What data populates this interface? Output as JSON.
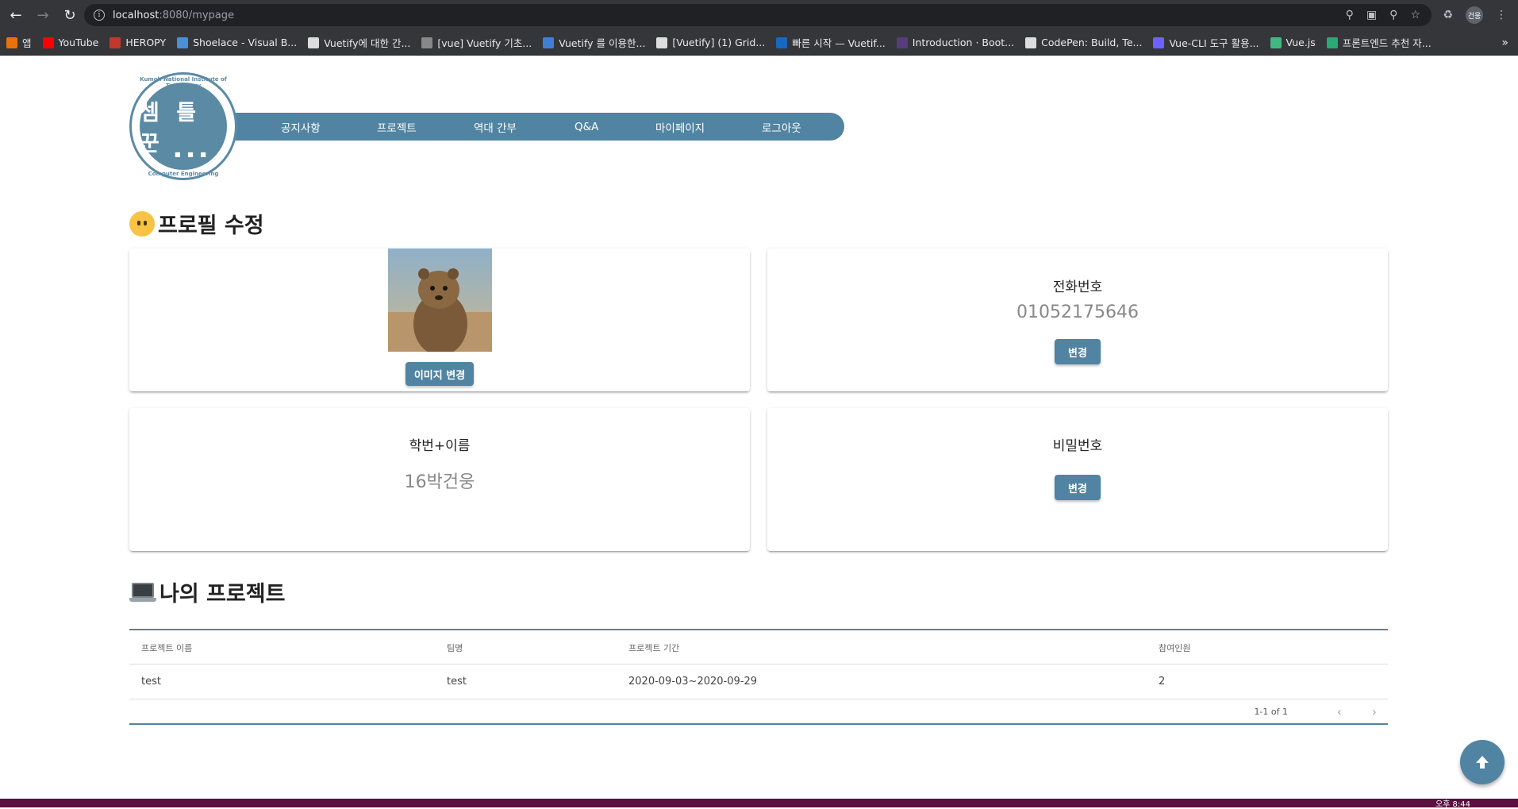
{
  "browser": {
    "url_host": "localhost",
    "url_rest": ":8080/mypage",
    "profile": "건웅",
    "bookmarks": [
      {
        "label": "앱",
        "color": "#e8710a"
      },
      {
        "label": "YouTube",
        "color": "#ff0000"
      },
      {
        "label": "HEROPY",
        "color": "#c0392b"
      },
      {
        "label": "Shoelace - Visual B...",
        "color": "#4a90d9"
      },
      {
        "label": "Vuetify에 대한 간...",
        "color": "#dddddd"
      },
      {
        "label": "[vue] Vuetify 기초...",
        "color": "#888888"
      },
      {
        "label": "Vuetify 를 이용한...",
        "color": "#3f7fd6"
      },
      {
        "label": "[Vuetify] (1) Grid...",
        "color": "#dddddd"
      },
      {
        "label": "빠른 시작 — Vuetif...",
        "color": "#1867c0"
      },
      {
        "label": "Introduction · Boot...",
        "color": "#563d7c"
      },
      {
        "label": "CodePen: Build, Te...",
        "color": "#dddddd"
      },
      {
        "label": "Vue-CLI 도구 활용...",
        "color": "#6c63ff"
      },
      {
        "label": "Vue.js",
        "color": "#41b883"
      },
      {
        "label": "프론트엔드 추천 자...",
        "color": "#2aa876"
      }
    ]
  },
  "logo": {
    "name": "셈 틀 꾼",
    "top_text": "Kumoh National Institute of Technology",
    "bottom_text": "Computer Engineering"
  },
  "nav": {
    "items": [
      "공지사항",
      "프로젝트",
      "역대 간부",
      "Q&A",
      "마이페이지",
      "로그아웃"
    ]
  },
  "profile_section": {
    "title": "프로필 수정",
    "image_button": "이미지 변경",
    "phone_label": "전화번호",
    "phone_value": "01052175646",
    "phone_button": "변경",
    "id_label": "학번+이름",
    "id_value": "16박건웅",
    "password_label": "비밀번호",
    "password_button": "변경"
  },
  "projects_section": {
    "title": "나의 프로젝트",
    "headers": [
      "프로젝트 이름",
      "팀명",
      "프로젝트 기간",
      "참여인원"
    ],
    "rows": [
      [
        "test",
        "test",
        "2020-09-03~2020-09-29",
        "2"
      ]
    ],
    "pagination": "1-1 of 1"
  },
  "taskbar": {
    "clock": "오후 8:44"
  },
  "colors": {
    "primary": "#5084a2"
  }
}
